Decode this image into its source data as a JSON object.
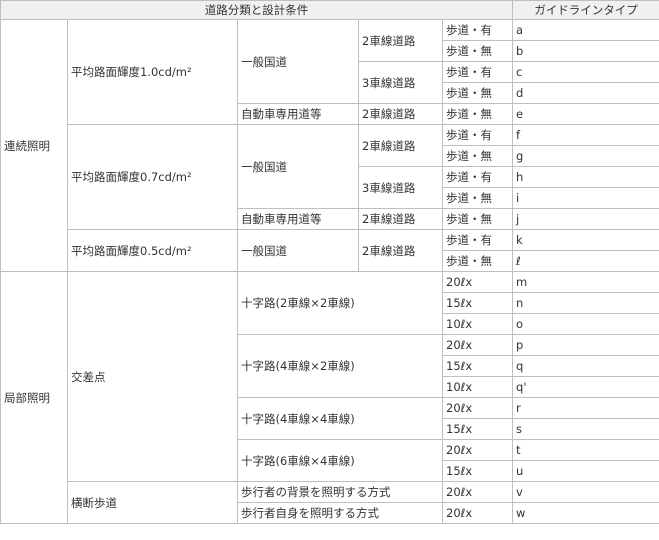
{
  "header": {
    "classification": "道路分類と設計条件",
    "guideline_type": "ガイドラインタイプ"
  },
  "continuous": {
    "label": "連続照明",
    "l10": {
      "label": "平均路面輝度1.0cd/m²",
      "general": "一般国道",
      "lanes2": "2車線道路",
      "lanes3": "3車線道路",
      "expressway": "自動車専用道等",
      "exp_lanes": "2車線道路",
      "rows": [
        {
          "cond": "歩道・有",
          "type": "a"
        },
        {
          "cond": "歩道・無",
          "type": "b"
        },
        {
          "cond": "歩道・有",
          "type": "c"
        },
        {
          "cond": "歩道・無",
          "type": "d"
        },
        {
          "cond": "歩道・無",
          "type": "e"
        }
      ]
    },
    "l07": {
      "label": "平均路面輝度0.7cd/m²",
      "general": "一般国道",
      "lanes2": "2車線道路",
      "lanes3": "3車線道路",
      "expressway": "自動車専用道等",
      "exp_lanes": "2車線道路",
      "rows": [
        {
          "cond": "歩道・有",
          "type": "f"
        },
        {
          "cond": "歩道・無",
          "type": "g"
        },
        {
          "cond": "歩道・有",
          "type": "h"
        },
        {
          "cond": "歩道・無",
          "type": "i"
        },
        {
          "cond": "歩道・無",
          "type": "j"
        }
      ]
    },
    "l05": {
      "label": "平均路面輝度0.5cd/m²",
      "general": "一般国道",
      "lanes2": "2車線道路",
      "rows": [
        {
          "cond": "歩道・有",
          "type": "k"
        },
        {
          "cond": "歩道・無",
          "type": "ℓ"
        }
      ]
    }
  },
  "local": {
    "label": "局部照明",
    "intersection": {
      "label": "交差点",
      "groups": [
        {
          "label": "十字路(2車線×2車線)",
          "rows": [
            {
              "cond": "20ℓx",
              "type": "m"
            },
            {
              "cond": "15ℓx",
              "type": "n"
            },
            {
              "cond": "10ℓx",
              "type": "o"
            }
          ]
        },
        {
          "label": "十字路(4車線×2車線)",
          "rows": [
            {
              "cond": "20ℓx",
              "type": "p"
            },
            {
              "cond": "15ℓx",
              "type": "q"
            },
            {
              "cond": "10ℓx",
              "type": "q'"
            }
          ]
        },
        {
          "label": "十字路(4車線×4車線)",
          "rows": [
            {
              "cond": "20ℓx",
              "type": "r"
            },
            {
              "cond": "15ℓx",
              "type": "s"
            }
          ]
        },
        {
          "label": "十字路(6車線×4車線)",
          "rows": [
            {
              "cond": "20ℓx",
              "type": "t"
            },
            {
              "cond": "15ℓx",
              "type": "u"
            }
          ]
        }
      ]
    },
    "crosswalk": {
      "label": "横断歩道",
      "rows": [
        {
          "label": "歩行者の背景を照明する方式",
          "cond": "20ℓx",
          "type": "v"
        },
        {
          "label": "歩行者自身を照明する方式",
          "cond": "20ℓx",
          "type": "w"
        }
      ]
    }
  }
}
